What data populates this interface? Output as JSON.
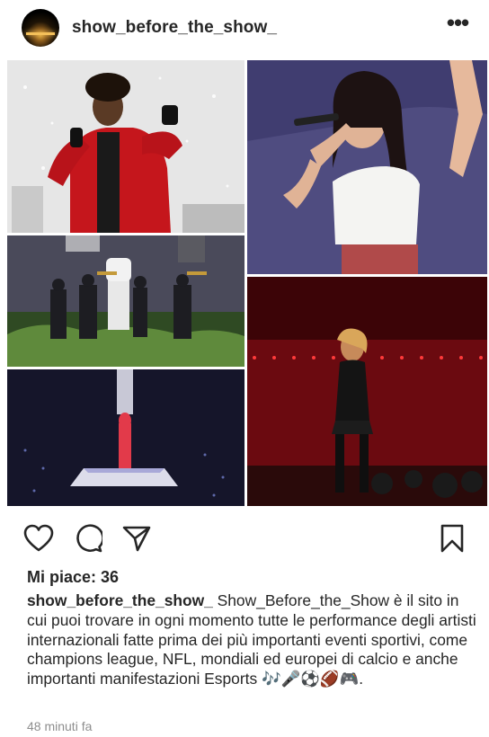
{
  "header": {
    "username": "show_before_the_show_",
    "more_label": "•••"
  },
  "post": {
    "images": [
      {
        "alt": ""
      },
      {
        "alt": ""
      },
      {
        "alt": ""
      },
      {
        "alt": ""
      },
      {
        "alt": ""
      }
    ]
  },
  "actions": {
    "icons": [
      "heart-icon",
      "comment-icon",
      "share-icon",
      "bookmark-icon"
    ]
  },
  "likes": {
    "label": "Mi piace: 36"
  },
  "caption": {
    "username": "show_before_the_show_",
    "text": "Show_Before_the_Show è il sito in cui puoi trovare in ogni momento tutte le performance degli artisti internazionali fatte prima dei più importanti eventi sportivi,  come champions league, NFL, mondiali ed europei di calcio e anche importanti manifestazioni Esports 🎶🎤⚽🏈🎮."
  },
  "timestamp": "48 minuti fa"
}
